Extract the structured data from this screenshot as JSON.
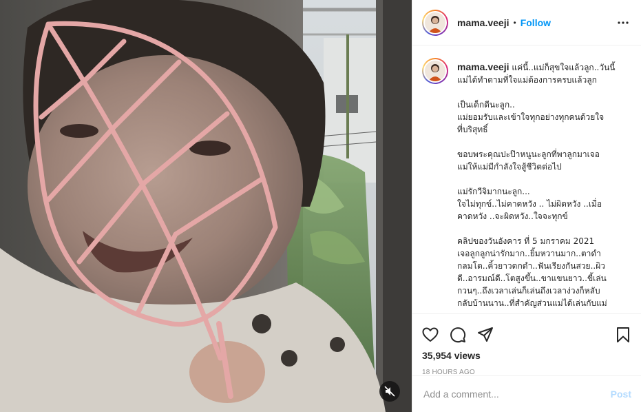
{
  "post": {
    "username": "mama.veeji",
    "follow_label": "Follow",
    "dot": "•",
    "caption_lines": [
      [
        "แค่นี้..แม่ก็สุขใจแล้วลูก..วันนี้",
        "แม่ได้ทำตามที่ใจแม่ต้องการครบแล้วลูก"
      ],
      [
        "เป็นเด็กดีนะลูก..",
        "แม่ยอมรับและเข้าใจทุกอย่างทุกคนด้วยใจ",
        "ที่บริสุทธิ์"
      ],
      [
        "ขอบพระคุณปะป๊าหนูนะลูกที่พาลูกมาเจอ",
        "แม่ให้แม่มีกำลังใจสู้ชีวิตต่อไป"
      ],
      [
        "แม่รักวีจิมากนะลูก...",
        "ใจไม่ทุกข์..ไม่คาดหวัง .. ไม่ผิดหวัง ..เมื่อ",
        "คาดหวัง ..จะผิดหวัง..ใจจะทุกข์"
      ],
      [
        "คลิปของวันอังคาร ที่ 5 มกราคม 2021",
        "เจอลูกลูกน่ารักมาก..ยิ้มหวานมาก..ตาดำ",
        "กลมโต..คิ้วยาวดกดำ..ฟันเรียงกันสวย..ผิว",
        "ดี..อารมณ์ดี..โตสูงขึ้น..ขาแขนยาว..ขี้เล่น",
        "กวนๆ..ถึงเวลาเล่นก็เล่นถึงเวลาง่วงก็หลับ",
        "กลับบ้านนาน..ที่สำคัญส่วนแม่ได้เล่นกับแม่"
      ]
    ],
    "views": "35,954 views",
    "time": "18 HOURS AGO",
    "comment_placeholder": "Add a comment...",
    "post_label": "Post"
  },
  "icons": {
    "more": "more-options-icon",
    "like": "heart-icon",
    "comment": "comment-icon",
    "share": "share-icon",
    "save": "bookmark-icon",
    "mute": "speaker-muted-icon"
  },
  "colors": {
    "link": "#0095f6",
    "post_disabled": "#b3dbff",
    "muted_text": "#8e8e8e"
  }
}
